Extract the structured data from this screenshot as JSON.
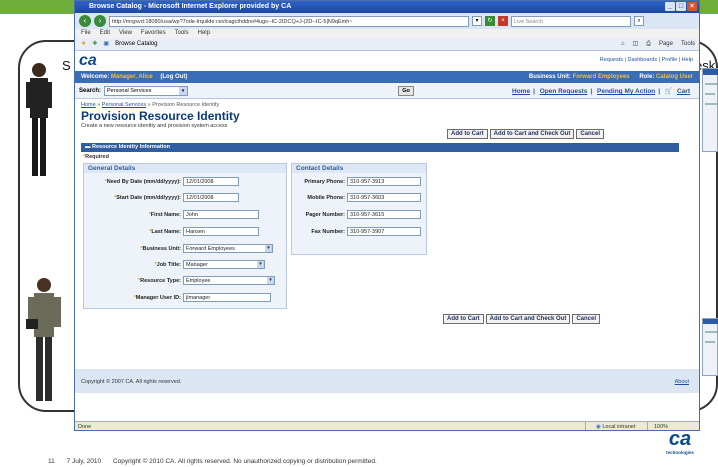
{
  "browser": {
    "window_title": "Browse Catalog - Microsoft Internet Explorer provided by CA",
    "address": "http://mrgsvd:18080/usa/wp?7ode-lrquilde:cevlcagcthddre#4ugs--IC-2IDCQ+J-(2D--IC-5|N9qEmh~",
    "search_placeholder": "Live Search",
    "menu": [
      "File",
      "Edit",
      "View",
      "Favorites",
      "Tools",
      "Help"
    ],
    "tab_title": "Browse Catalog",
    "toolbar_page": "Page",
    "toolbar_tools": "Tools",
    "status_left": "Done",
    "status_zone": "Local intranet",
    "status_zoom": "100%"
  },
  "app": {
    "logo": "ca",
    "top_links": "Requests | Dashboards | Profile | Help",
    "welcome_prefix": "Welcome:",
    "welcome_user": "Manager, Alice",
    "logout": "(Log Out)",
    "business_unit_label": "Business Unit:",
    "business_unit_value": "Forward Employees",
    "role_label": "Role:",
    "role_value": "Catalog User",
    "search_label": "Search:",
    "search_select": "Personal Services",
    "go": "Go",
    "nav_links": [
      "Home",
      "Open Requests",
      "Pending My Action",
      "Cart"
    ],
    "breadcrumb": [
      "Home",
      "Personal Services",
      "Provision Resource Identity"
    ],
    "page_title": "Provision Resource Identity",
    "page_desc": "Create a new resource identity and provision system access",
    "buttons": {
      "add_to_cart": "Add to Cart",
      "add_checkout": "Add to Cart and Check Out",
      "cancel": "Cancel"
    },
    "section_title": "Resource Identity Information",
    "required": "Required",
    "general": {
      "title": "General Details",
      "fields": [
        {
          "label": "Need By Date (mm/dd/yyyy):",
          "value": "12/01/2008"
        },
        {
          "label": "Start Date (mm/dd/yyyy):",
          "value": "12/01/2008"
        },
        {
          "label": "First Name:",
          "value": "John"
        },
        {
          "label": "Last Name:",
          "value": "Hansen"
        },
        {
          "label": "Business Unit:",
          "value": "Forward Employees"
        },
        {
          "label": "Job Title:",
          "value": "Manager"
        },
        {
          "label": "Resource Type:",
          "value": "Employee"
        },
        {
          "label": "Manager User ID:",
          "value": "jlmanager"
        }
      ]
    },
    "contact": {
      "title": "Contact Details",
      "fields": [
        {
          "label": "Primary Phone:",
          "value": "310-957-3913"
        },
        {
          "label": "Mobile Phone:",
          "value": "310-957-3603"
        },
        {
          "label": "Pager Number:",
          "value": "310-957-3615"
        },
        {
          "label": "Fax Number:",
          "value": "310-957-3907"
        }
      ]
    },
    "copyright": "Copyright © 2007 CA. All rights reserved.",
    "about": "About"
  },
  "slide": {
    "peek_left": "S",
    "peek_right": "esk",
    "footer_num": "11",
    "footer_date": "7 July, 2010",
    "footer_text": "Copyright © 2010 CA. All rights reserved. No unauthorized copying or distribution permitted.",
    "corner_logo": "ca",
    "corner_tag": "technologies"
  }
}
